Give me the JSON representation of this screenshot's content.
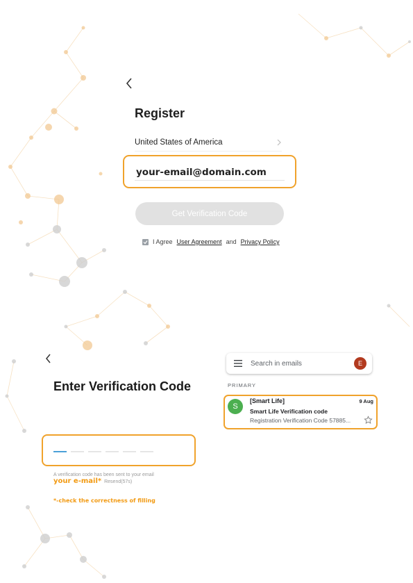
{
  "register": {
    "title": "Register",
    "country": "United States of America",
    "email_value": "your-email@domain.com",
    "get_code_label": "Get Verification Code",
    "agree_prefix": "I Agree",
    "user_agreement": "User Agreement",
    "and": "and",
    "privacy_policy": "Privacy Policy"
  },
  "verification": {
    "title": "Enter Verification Code",
    "sent_text": "A verification code has been sent to your email",
    "email_note": "your e-mail*",
    "resend": "Resend(57s)",
    "check_note": "*-check the correctness of filling"
  },
  "gmail": {
    "search_placeholder": "Search in emails",
    "avatar_letter": "E",
    "section_label": "PRIMARY",
    "mail": {
      "avatar_letter": "S",
      "sender": "[Smart Life]",
      "date": "9 Aug",
      "subject": "Smart Life Verification code",
      "snippet": "Registration Verification Code 57885..."
    }
  },
  "colors": {
    "highlight": "#f0a22b",
    "note_orange": "#f29a12",
    "button_disabled": "#e1e1e1",
    "gmail_avatar": "#b23a1f",
    "mail_avatar": "#4caf50"
  },
  "icons": [
    "back-chevron-icon",
    "chevron-right-icon",
    "check-icon",
    "menu-icon",
    "star-icon"
  ]
}
